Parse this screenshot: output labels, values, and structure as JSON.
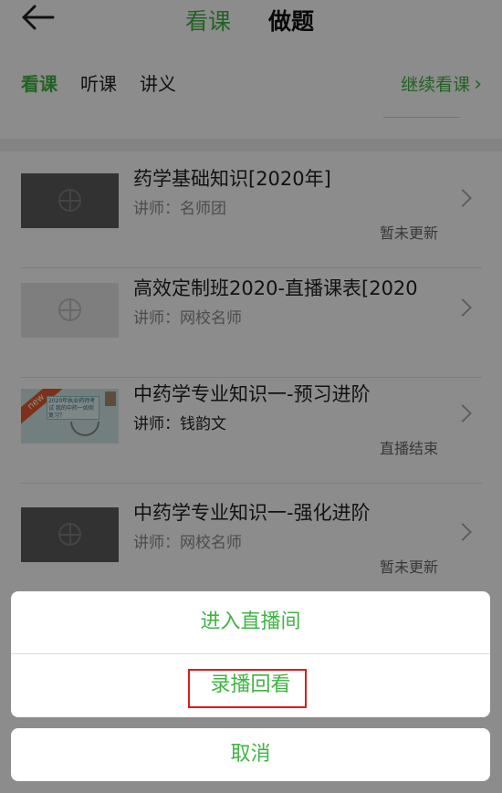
{
  "header": {
    "tabs": [
      {
        "label": "看课",
        "active": true
      },
      {
        "label": "做题",
        "active": false
      }
    ]
  },
  "subtabs": [
    {
      "label": "看课",
      "active": true
    },
    {
      "label": "听课",
      "active": false
    },
    {
      "label": "讲义",
      "active": false
    }
  ],
  "continue_label": "继续看课",
  "courses": [
    {
      "title": "药学基础知识[2020年]",
      "teacher": "讲师：名师团",
      "status": "暂未更新",
      "thumb": "placeholder-dark"
    },
    {
      "title": "高效定制班2020-直播课表[2020",
      "teacher": "讲师：网校名师",
      "status": "",
      "thumb": "placeholder-light"
    },
    {
      "title": "中药学专业知识一-预习进阶",
      "teacher": "讲师：钱韵文",
      "status": "直播结束",
      "thumb": "new-banner"
    },
    {
      "title": "中药学专业知识一-强化进阶",
      "teacher": "讲师：网校名师",
      "status": "暂未更新",
      "thumb": "placeholder-dark"
    }
  ],
  "thumb_banner_text": "2020年执业药师考试 我的中药一如何复习？",
  "thumb_ribbon_text": "new",
  "action_sheet": {
    "items": [
      {
        "label": "进入直播间"
      },
      {
        "label": "录播回看"
      }
    ],
    "cancel_label": "取消"
  },
  "colors": {
    "accent": "#3fb542",
    "highlight_border": "#e01c1c",
    "overlay": "rgba(0,0,0,0.45)"
  }
}
